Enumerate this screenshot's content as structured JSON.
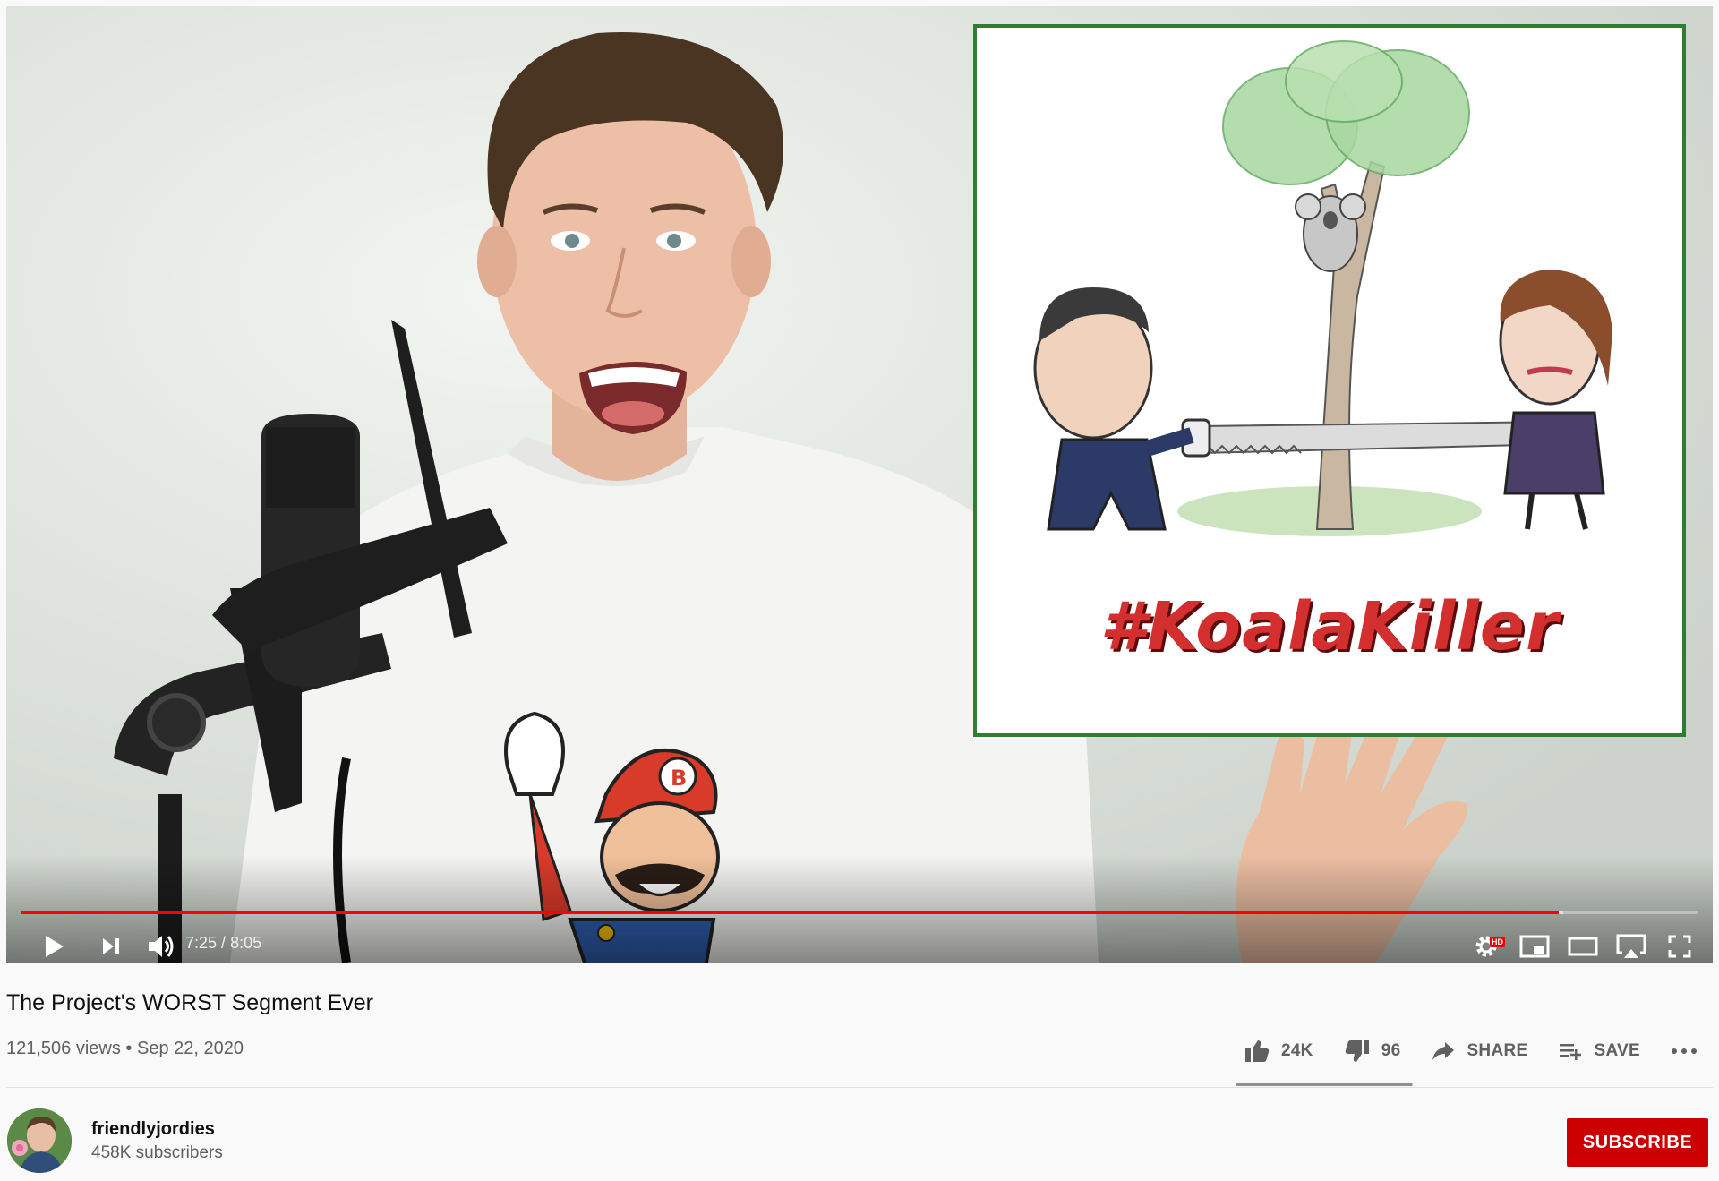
{
  "player": {
    "time_current": "7:25",
    "time_separator": " / ",
    "time_total": "8:05",
    "progress_played_fraction": 0.917,
    "progress_loaded_fraction": 0.92,
    "overlay_caption": "#KoalaKiller",
    "hd_badge": "HD",
    "accent_color": "#ff0000",
    "controls": [
      "play-icon",
      "next-icon",
      "volume-icon",
      "settings-icon",
      "miniplayer-icon",
      "theater-icon",
      "airplay-icon",
      "fullscreen-icon"
    ]
  },
  "video": {
    "title": "The Project's WORST Segment Ever",
    "views": "121,506 views",
    "separator": " • ",
    "date": "Sep 22, 2020"
  },
  "actions": {
    "like_count": "24K",
    "dislike_count": "96",
    "share_label": "SHARE",
    "save_label": "SAVE",
    "like_ratio": 0.996
  },
  "channel": {
    "name": "friendlyjordies",
    "subscribers": "458K subscribers",
    "subscribe_label": "SUBSCRIBE",
    "subscribe_color": "#cc0000"
  }
}
